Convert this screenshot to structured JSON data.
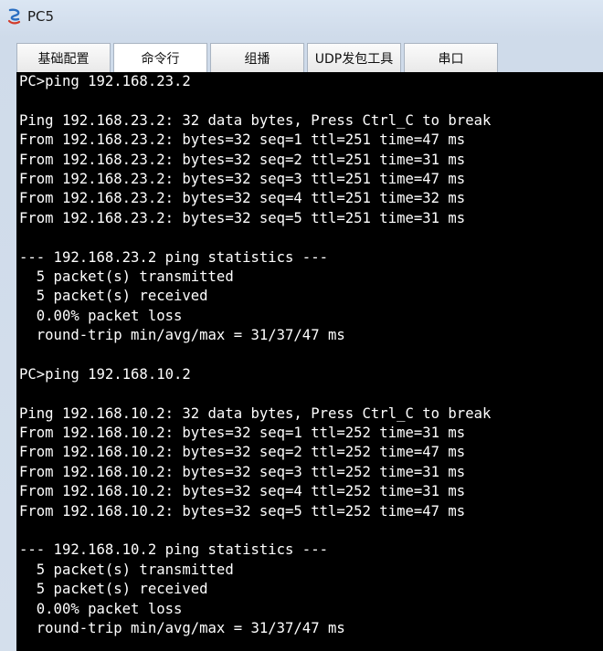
{
  "window": {
    "title": "PC5"
  },
  "tabs": [
    {
      "label": "基础配置"
    },
    {
      "label": "命令行"
    },
    {
      "label": "组播"
    },
    {
      "label": "UDP发包工具"
    },
    {
      "label": "串口"
    }
  ],
  "terminal": {
    "lines": [
      "PC>ping 192.168.23.2",
      "",
      "Ping 192.168.23.2: 32 data bytes, Press Ctrl_C to break",
      "From 192.168.23.2: bytes=32 seq=1 ttl=251 time=47 ms",
      "From 192.168.23.2: bytes=32 seq=2 ttl=251 time=31 ms",
      "From 192.168.23.2: bytes=32 seq=3 ttl=251 time=47 ms",
      "From 192.168.23.2: bytes=32 seq=4 ttl=251 time=32 ms",
      "From 192.168.23.2: bytes=32 seq=5 ttl=251 time=31 ms",
      "",
      "--- 192.168.23.2 ping statistics ---",
      "  5 packet(s) transmitted",
      "  5 packet(s) received",
      "  0.00% packet loss",
      "  round-trip min/avg/max = 31/37/47 ms",
      "",
      "PC>ping 192.168.10.2",
      "",
      "Ping 192.168.10.2: 32 data bytes, Press Ctrl_C to break",
      "From 192.168.10.2: bytes=32 seq=1 ttl=252 time=31 ms",
      "From 192.168.10.2: bytes=32 seq=2 ttl=252 time=47 ms",
      "From 192.168.10.2: bytes=32 seq=3 ttl=252 time=31 ms",
      "From 192.168.10.2: bytes=32 seq=4 ttl=252 time=31 ms",
      "From 192.168.10.2: bytes=32 seq=5 ttl=252 time=47 ms",
      "",
      "--- 192.168.10.2 ping statistics ---",
      "  5 packet(s) transmitted",
      "  5 packet(s) received",
      "  0.00% packet loss",
      "  round-trip min/avg/max = 31/37/47 ms"
    ]
  }
}
